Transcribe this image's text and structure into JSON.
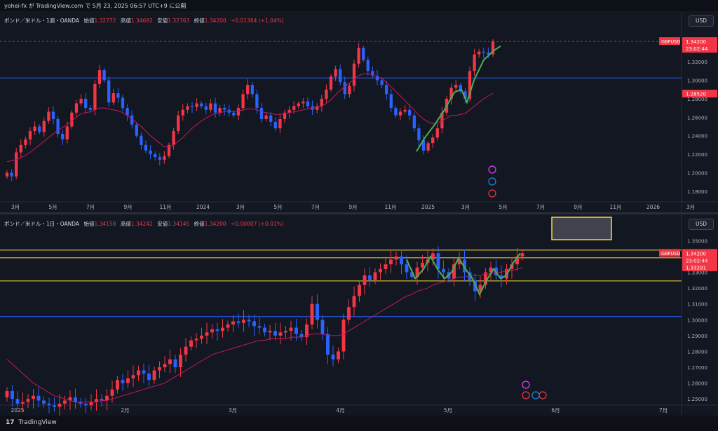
{
  "header": {
    "text": "yohei-fx が TradingView.com で 5月 23, 2025 06:57 UTC+9 に公開"
  },
  "footer": {
    "logo": "17",
    "brand": "TradingView"
  },
  "colors": {
    "up": "#f23645",
    "down": "#2962ff",
    "ma": "#c2185b",
    "green": "#4caf50",
    "yellow": "#fdd835",
    "hline": "#2962ff"
  },
  "pane1": {
    "title": "ポンド／米ドル・1週・OANDA",
    "open_label": "始値",
    "open": "1.32772",
    "high_label": "高値",
    "high": "1.34692",
    "low_label": "安値",
    "low": "1.32763",
    "close_label": "終値",
    "close": "1.34200",
    "change": "+0.01384 (+1.04%)",
    "currency": "USD",
    "price_ticks": [
      "1.32000",
      "1.30000",
      "1.28000",
      "1.26000",
      "1.24000",
      "1.22000",
      "1.20000",
      "1.18000"
    ],
    "time_ticks": [
      "3月",
      "5月",
      "7月",
      "9月",
      "11月",
      "2024",
      "3月",
      "5月",
      "7月",
      "9月",
      "11月",
      "2025",
      "3月",
      "5月",
      "7月",
      "9月",
      "11月",
      "2026",
      "3月"
    ],
    "price_tag": {
      "symbol": "GBPUSD",
      "price": "1.34200",
      "timer": "23:02:44"
    },
    "level_tag": "1.28520",
    "chart_data": {
      "type": "candlestick",
      "ylim": [
        1.17,
        1.355
      ],
      "horizontal_line": 1.3025,
      "dashed_line": 1.342,
      "closes": [
        1.2,
        1.196,
        1.222,
        1.23,
        1.236,
        1.245,
        1.25,
        1.244,
        1.256,
        1.266,
        1.258,
        1.242,
        1.236,
        1.25,
        1.265,
        1.275,
        1.28,
        1.27,
        1.268,
        1.296,
        1.311,
        1.3,
        1.276,
        1.286,
        1.281,
        1.27,
        1.262,
        1.252,
        1.24,
        1.23,
        1.224,
        1.22,
        1.217,
        1.214,
        1.218,
        1.23,
        1.245,
        1.262,
        1.268,
        1.272,
        1.271,
        1.275,
        1.272,
        1.268,
        1.275,
        1.265,
        1.27,
        1.268,
        1.265,
        1.262,
        1.27,
        1.285,
        1.295,
        1.285,
        1.27,
        1.258,
        1.262,
        1.255,
        1.248,
        1.258,
        1.265,
        1.268,
        1.272,
        1.275,
        1.277,
        1.272,
        1.268,
        1.272,
        1.28,
        1.29,
        1.304,
        1.312,
        1.298,
        1.285,
        1.294,
        1.318,
        1.335,
        1.322,
        1.31,
        1.305,
        1.3,
        1.295,
        1.285,
        1.27,
        1.262,
        1.266,
        1.268,
        1.262,
        1.248,
        1.235,
        1.224,
        1.232,
        1.238,
        1.248,
        1.265,
        1.28,
        1.292,
        1.295,
        1.288,
        1.28,
        1.31,
        1.328,
        1.331,
        1.33,
        1.328,
        1.342
      ],
      "ma": [
        1.212,
        1.213,
        1.214,
        1.216,
        1.219,
        1.222,
        1.226,
        1.23,
        1.234,
        1.238,
        1.242,
        1.246,
        1.249,
        1.252,
        1.256,
        1.26,
        1.264,
        1.265,
        1.266,
        1.268,
        1.27,
        1.27,
        1.269,
        1.268,
        1.267,
        1.265,
        1.262,
        1.258,
        1.254,
        1.25,
        1.245,
        1.24,
        1.236,
        1.232,
        1.228,
        1.228,
        1.23,
        1.234,
        1.238,
        1.243,
        1.248,
        1.252,
        1.256,
        1.259,
        1.262,
        1.264,
        1.265,
        1.266,
        1.266,
        1.266,
        1.267,
        1.268,
        1.269,
        1.269,
        1.268,
        1.266,
        1.265,
        1.264,
        1.263,
        1.263,
        1.264,
        1.265,
        1.266,
        1.267,
        1.268,
        1.269,
        1.27,
        1.271,
        1.272,
        1.275,
        1.279,
        1.284,
        1.289,
        1.293,
        1.297,
        1.301,
        1.305,
        1.307,
        1.307,
        1.306,
        1.304,
        1.302,
        1.298,
        1.293,
        1.288,
        1.283,
        1.278,
        1.273,
        1.268,
        1.262,
        1.258,
        1.255,
        1.253,
        1.254,
        1.256,
        1.259,
        1.262,
        1.262,
        1.263,
        1.264,
        1.268,
        1.272,
        1.276,
        1.28,
        1.283,
        1.286
      ]
    }
  },
  "pane2": {
    "title": "ポンド／米ドル・1日・OANDA",
    "open_label": "始値",
    "open": "1.34158",
    "high_label": "高値",
    "high": "1.34242",
    "low_label": "安値",
    "low": "1.34145",
    "close_label": "終値",
    "close": "1.34200",
    "change": "+0.00007 (+0.01%)",
    "currency": "USD",
    "price_ticks": [
      "1.35000",
      "1.34000",
      "1.33000",
      "1.32000",
      "1.31000",
      "1.30000",
      "1.29000",
      "1.28000",
      "1.27000",
      "1.26000",
      "1.25000"
    ],
    "time_ticks": [
      "2025",
      "2月",
      "3月",
      "4月",
      "5月",
      "6月",
      "7月"
    ],
    "price_tag": {
      "symbol": "GBPUSD",
      "price": "1.34200",
      "timer": "23:02:44"
    },
    "level_tag": "1.33291",
    "chart_data": {
      "type": "candlestick",
      "ylim": [
        1.247,
        1.355
      ],
      "horizontal_lines": [
        1.302
      ],
      "yellow_lines": [
        1.344,
        1.3391,
        1.3245
      ],
      "closes": [
        1.255,
        1.25,
        1.247,
        1.248,
        1.25,
        1.252,
        1.249,
        1.247,
        1.246,
        1.245,
        1.247,
        1.249,
        1.251,
        1.248,
        1.247,
        1.246,
        1.248,
        1.25,
        1.249,
        1.252,
        1.256,
        1.262,
        1.26,
        1.263,
        1.265,
        1.268,
        1.266,
        1.262,
        1.268,
        1.27,
        1.272,
        1.275,
        1.27,
        1.278,
        1.283,
        1.287,
        1.288,
        1.29,
        1.292,
        1.294,
        1.293,
        1.295,
        1.297,
        1.299,
        1.298,
        1.3,
        1.299,
        1.296,
        1.295,
        1.292,
        1.293,
        1.29,
        1.292,
        1.293,
        1.295,
        1.291,
        1.289,
        1.297,
        1.31,
        1.3,
        1.291,
        1.278,
        1.275,
        1.28,
        1.3,
        1.308,
        1.315,
        1.322,
        1.328,
        1.325,
        1.33,
        1.332,
        1.335,
        1.338,
        1.34,
        1.335,
        1.33,
        1.327,
        1.333,
        1.336,
        1.338,
        1.342,
        1.332,
        1.33,
        1.326,
        1.335,
        1.338,
        1.33,
        1.325,
        1.318,
        1.322,
        1.33,
        1.333,
        1.328,
        1.326,
        1.332,
        1.335,
        1.34,
        1.342
      ],
      "ma": [
        1.275,
        1.272,
        1.269,
        1.266,
        1.263,
        1.26,
        1.258,
        1.256,
        1.254,
        1.252,
        1.251,
        1.25,
        1.249,
        1.248,
        1.248,
        1.248,
        1.248,
        1.248,
        1.249,
        1.249,
        1.25,
        1.251,
        1.252,
        1.253,
        1.254,
        1.255,
        1.256,
        1.257,
        1.258,
        1.259,
        1.26,
        1.262,
        1.264,
        1.266,
        1.268,
        1.27,
        1.272,
        1.274,
        1.276,
        1.278,
        1.279,
        1.28,
        1.281,
        1.282,
        1.283,
        1.284,
        1.285,
        1.286,
        1.287,
        1.287,
        1.288,
        1.288,
        1.288,
        1.288,
        1.289,
        1.289,
        1.289,
        1.29,
        1.291,
        1.291,
        1.291,
        1.29,
        1.29,
        1.29,
        1.291,
        1.293,
        1.295,
        1.297,
        1.299,
        1.301,
        1.303,
        1.305,
        1.307,
        1.309,
        1.311,
        1.313,
        1.315,
        1.316,
        1.318,
        1.319,
        1.32,
        1.322,
        1.323,
        1.324,
        1.325,
        1.326,
        1.327,
        1.327,
        1.328,
        1.328,
        1.328,
        1.329,
        1.329,
        1.33,
        1.33,
        1.331,
        1.331,
        1.332,
        1.333
      ]
    }
  }
}
